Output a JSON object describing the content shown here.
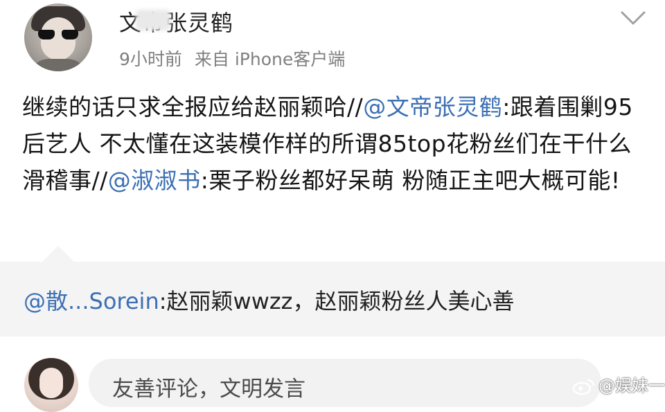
{
  "post": {
    "username": "文帝张灵鹤",
    "time": "9小时前",
    "source": "来自 iPhone客户端",
    "text_part1": "继续的话只求全报应给赵丽颖哈//",
    "mention1": "@文帝张灵鹤",
    "text_part2": ":跟着围剿95后艺人 不太懂在这装模作样的所谓85top花粉丝们在干什么滑稽事//",
    "mention2": "@淑淑书",
    "text_part3": ":栗子粉丝都好呆萌 粉随正主吧大概可能!"
  },
  "reply": {
    "mention": "@散...Sorein",
    "text": ":赵丽颖wwzz，赵丽颖粉丝人美心善"
  },
  "footer": {
    "comment_placeholder": "友善评论，文明发言",
    "watermark": "@娱妹一"
  },
  "icons": {
    "dropdown": "chevron-down-icon",
    "watermark_logo": "weibo-logo-icon"
  },
  "colors": {
    "mention": "#3c6fb4",
    "meta_text": "#7f7f7f",
    "reply_bg": "#f4f4f4",
    "comment_bg": "#f2f2f2"
  }
}
